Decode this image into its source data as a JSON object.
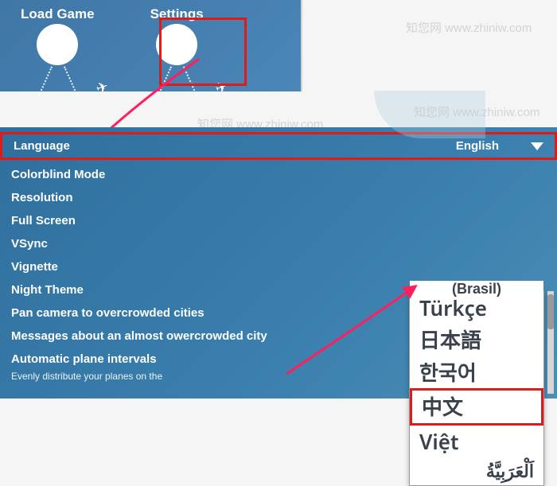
{
  "top": {
    "load_label": "Load Game",
    "settings_label": "Settings"
  },
  "watermark": "知您网 www.zhiniw.com",
  "settings": {
    "language_label": "Language",
    "language_value": "English",
    "items": [
      "Colorblind Mode",
      "Resolution",
      "Full Screen",
      "VSync",
      "Vignette",
      "Night Theme",
      "Pan camera to overcrowded cities",
      "Messages about an almost owercrowded city",
      "Automatic plane intervals"
    ],
    "auto_sub": "Evenly distribute your planes on the"
  },
  "dropdown": {
    "cut_top": "(Brasil)",
    "items": [
      "Türkçe",
      "日本語",
      "한국어",
      "中文",
      "Việt",
      "اَلْعَرَبِيَّةُ"
    ],
    "highlight_index": 3
  }
}
